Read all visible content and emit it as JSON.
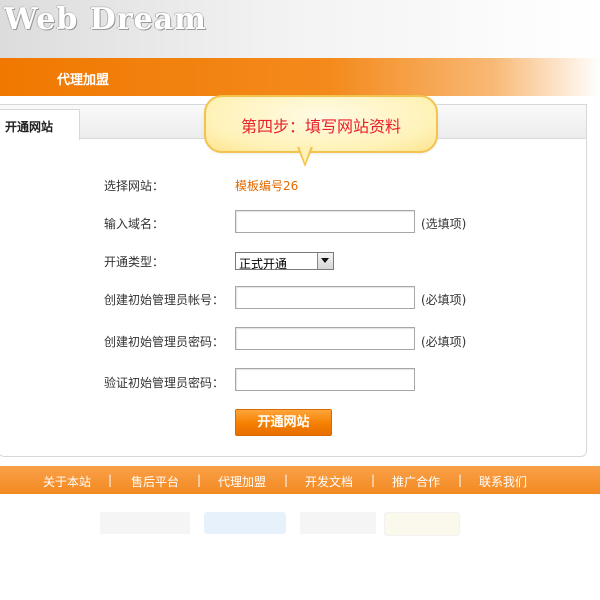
{
  "header": {
    "logo": "Web Dream"
  },
  "nav": {
    "items": [
      {
        "label": "代理加盟"
      }
    ]
  },
  "tabs": [
    {
      "label": "开通网站"
    }
  ],
  "callout": {
    "text": "第四步：填写网站资料"
  },
  "form": {
    "site_label": "选择网站：",
    "site_value": "模板编号26",
    "domain_label": "输入域名：",
    "domain_value": "",
    "domain_hint": "(选填项)",
    "type_label": "开通类型：",
    "type_selected": "正式开通",
    "account_label": "创建初始管理员帐号：",
    "account_value": "",
    "account_hint": "(必填项)",
    "password_label": "创建初始管理员密码：",
    "password_value": "",
    "password_hint": "(必填项)",
    "verify_label": "验证初始管理员密码：",
    "verify_value": "",
    "submit_label": "开通网站"
  },
  "footer": {
    "links": [
      "关于本站",
      "售后平台",
      "代理加盟",
      "开发文档",
      "推广合作",
      "联系我们"
    ],
    "separator": "|"
  }
}
